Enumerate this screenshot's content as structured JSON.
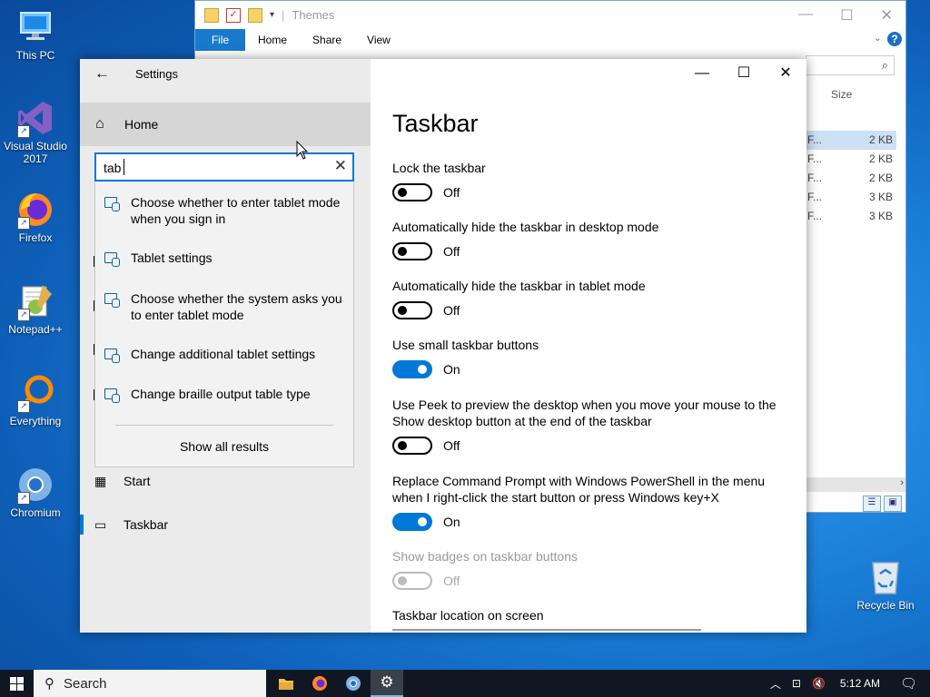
{
  "desktop": {
    "icons": [
      {
        "label": "This PC"
      },
      {
        "label": "Visual Studio 2017"
      },
      {
        "label": "Firefox"
      },
      {
        "label": "Notepad++"
      },
      {
        "label": "Everything"
      },
      {
        "label": "Chromium"
      },
      {
        "label": "Recycle Bin"
      }
    ]
  },
  "explorer": {
    "title": "Themes",
    "ribbon_tabs": [
      "File",
      "Home",
      "Share",
      "View"
    ],
    "column_size": "Size",
    "rows": [
      {
        "type": "F...",
        "size": "2 KB",
        "selected": true
      },
      {
        "type": "F...",
        "size": "2 KB",
        "selected": false
      },
      {
        "type": "F...",
        "size": "2 KB",
        "selected": false
      },
      {
        "type": "F...",
        "size": "3 KB",
        "selected": false
      },
      {
        "type": "F...",
        "size": "3 KB",
        "selected": false
      }
    ]
  },
  "settings": {
    "app_title": "Settings",
    "nav": {
      "home_label": "Home",
      "items": [
        {
          "label": "Start",
          "icon": "start-icon"
        },
        {
          "label": "Taskbar",
          "icon": "taskbar-icon",
          "active": true
        }
      ]
    },
    "search": {
      "value": "tab",
      "suggestions": [
        "Choose whether to enter tablet mode when you sign in",
        "Tablet settings",
        "Choose whether the system asks you to enter tablet mode",
        "Change additional tablet settings",
        "Change braille output table type"
      ],
      "show_all": "Show all results"
    },
    "page": {
      "title": "Taskbar",
      "settings": [
        {
          "label": "Lock the taskbar",
          "state": "Off",
          "on": false,
          "disabled": false
        },
        {
          "label": "Automatically hide the taskbar in desktop mode",
          "state": "Off",
          "on": false,
          "disabled": false
        },
        {
          "label": "Automatically hide the taskbar in tablet mode",
          "state": "Off",
          "on": false,
          "disabled": false
        },
        {
          "label": "Use small taskbar buttons",
          "state": "On",
          "on": true,
          "disabled": false
        },
        {
          "label": "Use Peek to preview the desktop when you move your mouse to the Show desktop button at the end of the taskbar",
          "state": "Off",
          "on": false,
          "disabled": false
        },
        {
          "label": "Replace Command Prompt with Windows PowerShell in the menu when I right-click the start button or press Windows key+X",
          "state": "On",
          "on": true,
          "disabled": false
        },
        {
          "label": "Show badges on taskbar buttons",
          "state": "Off",
          "on": false,
          "disabled": true
        }
      ],
      "location_label": "Taskbar location on screen"
    }
  },
  "taskbar": {
    "search_placeholder": "Search",
    "time": "5:12 AM",
    "accent": "#0078d7"
  }
}
